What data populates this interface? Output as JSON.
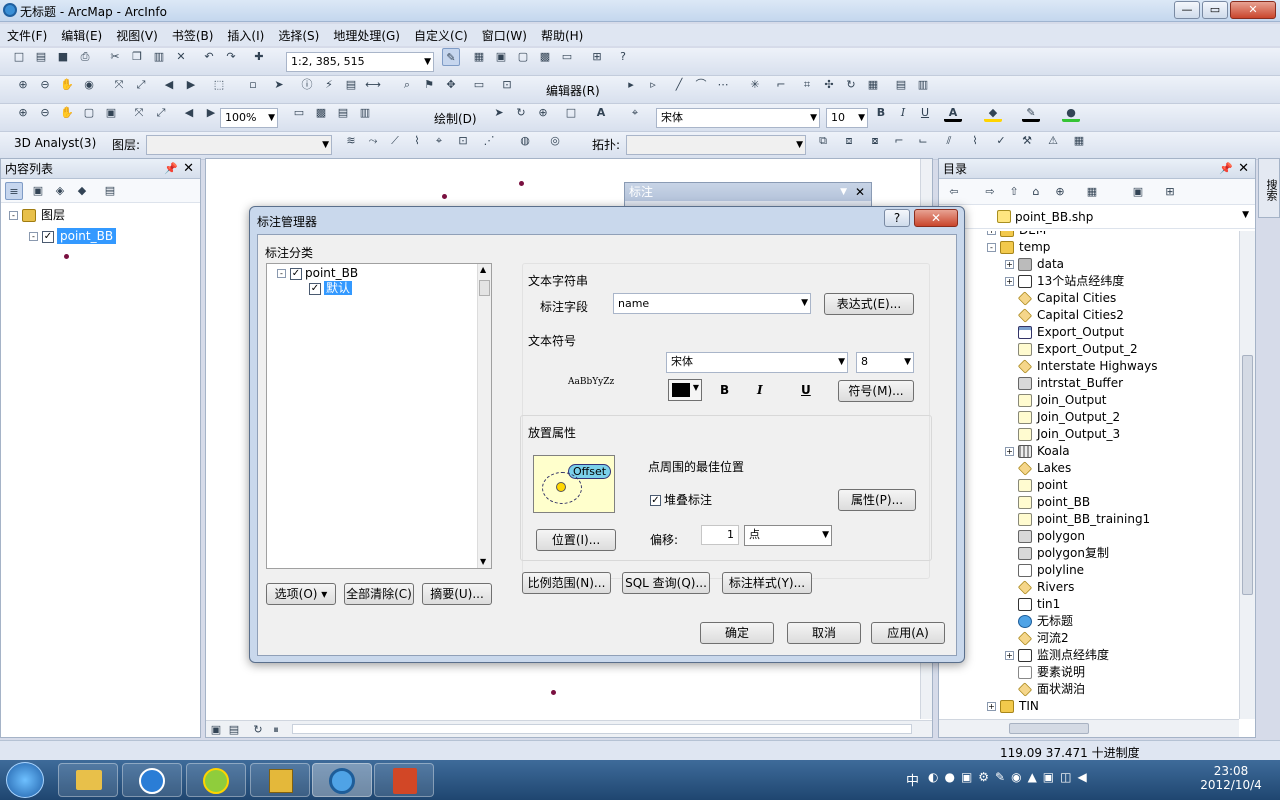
{
  "window": {
    "title": "无标题 - ArcMap - ArcInfo",
    "min": "—",
    "max": "▭",
    "close": "✕"
  },
  "menu": [
    "文件(F)",
    "编辑(E)",
    "视图(V)",
    "书签(B)",
    "插入(I)",
    "选择(S)",
    "地理处理(G)",
    "自定义(C)",
    "窗口(W)",
    "帮助(H)"
  ],
  "toolbar": {
    "scale": "1:2, 385, 515",
    "editor": "编辑器(R)",
    "zoom": "100%",
    "draw": "绘制(D)",
    "font": "宋体",
    "fontsize": "10",
    "bold": "B",
    "italic": "I",
    "underline": "U",
    "analyst": "3D Analyst(3)",
    "layer_label": "图层:",
    "topology_label": "拓扑:"
  },
  "toc": {
    "title": "内容列表",
    "root": "图层",
    "layer": "point_BB"
  },
  "catalog": {
    "title": "目录",
    "location": "point_BB.shp",
    "items": [
      {
        "n": "DEM",
        "i": "folder",
        "lvl": 1,
        "exp": "+"
      },
      {
        "n": "temp",
        "i": "folder",
        "lvl": 1,
        "exp": "-"
      },
      {
        "n": "data",
        "i": "db",
        "lvl": 2,
        "exp": "+"
      },
      {
        "n": "13个站点经纬度",
        "i": "fc",
        "lvl": 2,
        "exp": "+"
      },
      {
        "n": "Capital Cities",
        "i": "lyr",
        "lvl": 2,
        "exp": ""
      },
      {
        "n": "Capital Cities2",
        "i": "lyr",
        "lvl": 2,
        "exp": ""
      },
      {
        "n": "Export_Output",
        "i": "tbl",
        "lvl": 2,
        "exp": ""
      },
      {
        "n": "Export_Output_2",
        "i": "pt",
        "lvl": 2,
        "exp": ""
      },
      {
        "n": "Interstate Highways",
        "i": "lyr",
        "lvl": 2,
        "exp": ""
      },
      {
        "n": "intrstat_Buffer",
        "i": "poly",
        "lvl": 2,
        "exp": ""
      },
      {
        "n": "Join_Output",
        "i": "pt",
        "lvl": 2,
        "exp": ""
      },
      {
        "n": "Join_Output_2",
        "i": "pt",
        "lvl": 2,
        "exp": ""
      },
      {
        "n": "Join_Output_3",
        "i": "pt",
        "lvl": 2,
        "exp": ""
      },
      {
        "n": "Koala",
        "i": "grid",
        "lvl": 2,
        "exp": "+"
      },
      {
        "n": "Lakes",
        "i": "lyr",
        "lvl": 2,
        "exp": ""
      },
      {
        "n": "point",
        "i": "pt",
        "lvl": 2,
        "exp": ""
      },
      {
        "n": "point_BB",
        "i": "pt",
        "lvl": 2,
        "exp": ""
      },
      {
        "n": "point_BB_training1",
        "i": "pt",
        "lvl": 2,
        "exp": ""
      },
      {
        "n": "polygon",
        "i": "poly",
        "lvl": 2,
        "exp": ""
      },
      {
        "n": "polygon复制",
        "i": "poly",
        "lvl": 2,
        "exp": ""
      },
      {
        "n": "polyline",
        "i": "line",
        "lvl": 2,
        "exp": ""
      },
      {
        "n": "Rivers",
        "i": "lyr",
        "lvl": 2,
        "exp": ""
      },
      {
        "n": "tin1",
        "i": "tin",
        "lvl": 2,
        "exp": ""
      },
      {
        "n": "无标题",
        "i": "mxd",
        "lvl": 2,
        "exp": ""
      },
      {
        "n": "河流2",
        "i": "lyr",
        "lvl": 2,
        "exp": ""
      },
      {
        "n": "监测点经纬度",
        "i": "fc",
        "lvl": 2,
        "exp": "+"
      },
      {
        "n": "要素说明",
        "i": "doc",
        "lvl": 2,
        "exp": ""
      },
      {
        "n": "面状湖泊",
        "i": "lyr",
        "lvl": 2,
        "exp": ""
      },
      {
        "n": "TIN",
        "i": "folder",
        "lvl": 1,
        "exp": "+"
      }
    ],
    "side_tab": "搜索"
  },
  "label_toolbar": {
    "title": "标注"
  },
  "dialog": {
    "title": "标注管理器",
    "class_label": "标注分类",
    "tree_layer": "point_BB",
    "tree_class": "默认",
    "btn_options": "选项(O)",
    "btn_clear": "全部清除(C)",
    "btn_summary": "摘要(U)...",
    "text_string": "文本字符串",
    "label_field": "标注字段",
    "field_value": "name",
    "btn_expr": "表达式(E)...",
    "text_symbol": "文本符号",
    "preview": "AaBbYyZz",
    "font": "宋体",
    "size": "8",
    "bold": "B",
    "italic": "I",
    "underline": "U",
    "btn_symbol": "符号(M)...",
    "placement": "放置属性",
    "offset_word": "Offset",
    "placement_desc": "点周围的最佳位置",
    "stack_label": "堆叠标注",
    "btn_props": "属性(P)...",
    "btn_position": "位置(I)...",
    "offset_label": "偏移:",
    "offset_value": "1",
    "offset_unit": "点",
    "btn_scale": "比例范围(N)...",
    "btn_sql": "SQL 查询(Q)...",
    "btn_style": "标注样式(Y)...",
    "btn_ok": "确定",
    "btn_cancel": "取消",
    "btn_apply": "应用(A)",
    "help": "?",
    "close": "✕"
  },
  "status": {
    "coords": "119.09  37.471 十进制度"
  },
  "clock": {
    "time": "23:08",
    "date": "2012/10/4"
  },
  "tray": "中"
}
